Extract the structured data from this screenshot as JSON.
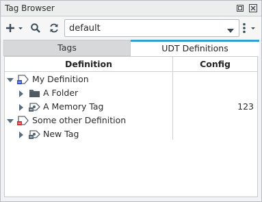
{
  "window": {
    "title": "Tag Browser",
    "controls": [
      "restore-icon",
      "close-icon"
    ]
  },
  "toolbar": {
    "add_icon": "plus-icon",
    "search_icon": "search-icon",
    "refresh_icon": "refresh-icon",
    "provider_value": "default",
    "menu_icon": "kebab-menu-icon"
  },
  "tabs": [
    {
      "label": "Tags",
      "active": false
    },
    {
      "label": "UDT Definitions",
      "active": true
    }
  ],
  "table": {
    "columns": [
      "Definition",
      "Config"
    ],
    "rows": [
      {
        "label": "My Definition",
        "icon": "udt-definition-icon",
        "expanded": true,
        "config": ""
      },
      {
        "label": "A Folder",
        "icon": "folder-icon",
        "expanded": false,
        "config": ""
      },
      {
        "label": "A Memory Tag",
        "icon": "memory-tag-icon",
        "expanded": false,
        "config": "123"
      },
      {
        "label": "Some other Definition",
        "icon": "udt-definition-icon",
        "expanded": true,
        "config": ""
      },
      {
        "label": "New Tag",
        "icon": "memory-tag-icon",
        "expanded": false,
        "config": ""
      }
    ]
  },
  "colors": {
    "accent": "#2f9fd6",
    "udt_blue_badge": "#2b4fd8",
    "udt_red_badge": "#e0292b",
    "icon_gray": "#5b6770"
  }
}
